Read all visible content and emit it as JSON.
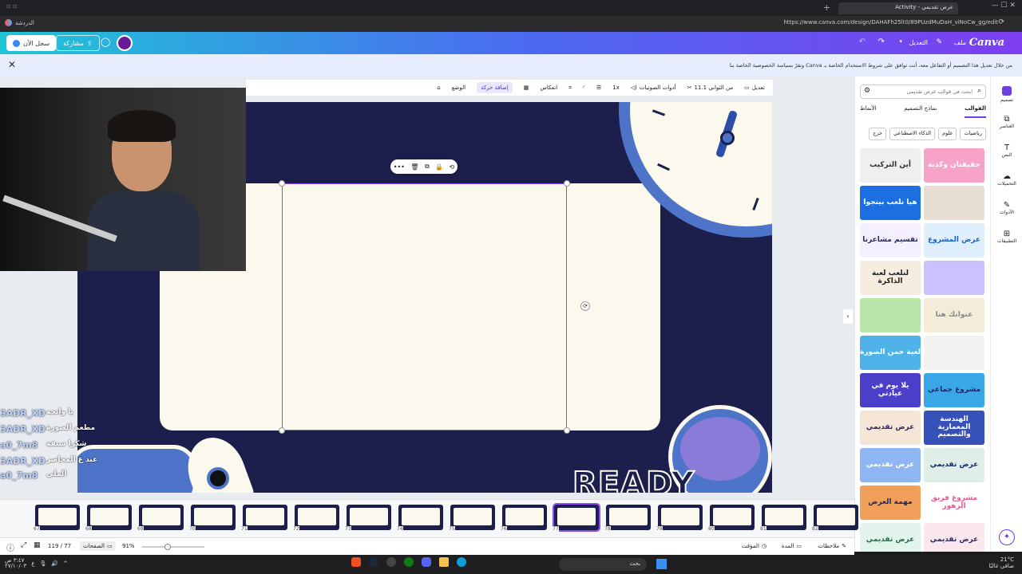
{
  "browser": {
    "tab_title": "عرض تقديمي - Activity",
    "url": "https://www.canva.com/design/DAHAFh25lt0/89PUzdMuDaH_viNoCw_gg/edit",
    "left_tab": "الدردشة"
  },
  "header": {
    "logo": "Canva",
    "menu_file": "ملف",
    "menu_edit": "التعديل",
    "share_label": "مشاركة",
    "signup_label": "سجل الآن"
  },
  "notice": {
    "text": "من خلال تعديل هذا التصميم أو التفاعل معه، أنت توافق على شروط الاستخدام الخاصة بـ Canva وتقرّ بسياسة الخصوصية الخاصة بنا",
    "close_icon": "close-icon"
  },
  "toolbar": {
    "edit": "تعديل",
    "duration": "11.1 من الثواني",
    "audio_tools": "أدوات الصوتيات",
    "speed": "1x",
    "flip": "انعكاس",
    "animate": "إضافة حركة",
    "position": "الوضع"
  },
  "slide": {
    "title_word": "READY",
    "colors": {
      "bg": "#1c1f4b",
      "card": "#fbf8ee",
      "accent": "#4e74c9",
      "selection": "#8a4bf0"
    }
  },
  "panel": {
    "search_placeholder": "ابحث في قوالب عرض تقديمي",
    "tabs": [
      "القوالب",
      "نماذج التصميم",
      "الأنماط"
    ],
    "chips": [
      "رياضيات",
      "علوم",
      "الذكاء الاصطناعي",
      "خرج"
    ],
    "templates": [
      {
        "label": "حقيقتان وكذبة",
        "bg": "#f7a3c8",
        "fg": "#ffffff"
      },
      {
        "label": "أين التركيب",
        "bg": "#efefef",
        "fg": "#333333"
      },
      {
        "label": "",
        "bg": "#e6dfd1",
        "fg": "#333333"
      },
      {
        "label": "هيا نلعب بينجوا",
        "bg": "#1b6fe0",
        "fg": "#ffffff"
      },
      {
        "label": "عرض المشروع",
        "bg": "#dfeefb",
        "fg": "#1b62c5"
      },
      {
        "label": "تقسيم مشاعرنا",
        "bg": "#f5f0ff",
        "fg": "#2b2b5b"
      },
      {
        "label": "",
        "bg": "#c9c2ff",
        "fg": "#333333"
      },
      {
        "label": "لنلعب لعبة الذاكرة",
        "bg": "#f6ede0",
        "fg": "#222222"
      },
      {
        "label": "عنوانك هنا",
        "bg": "#f3ecd8",
        "fg": "#888888"
      },
      {
        "label": "",
        "bg": "#b9e6a8",
        "fg": "#333333"
      },
      {
        "label": "",
        "bg": "#f2f2f2",
        "fg": "#333333"
      },
      {
        "label": "لعبة خمن الصورة",
        "bg": "#4fb3ea",
        "fg": "#ffffff"
      },
      {
        "label": "مشروع جماعي",
        "bg": "#3aa7e8",
        "fg": "#1b2a6b"
      },
      {
        "label": "يلا يوم في عيادتي",
        "bg": "#4b3fc9",
        "fg": "#ffffff"
      },
      {
        "label": "الهندسة المعمارية والتصميم",
        "bg": "#3651b8",
        "fg": "#ffffff"
      },
      {
        "label": "عرض تقديمي",
        "bg": "#f6e6d8",
        "fg": "#2b2b5b"
      },
      {
        "label": "عرض تقديمي",
        "bg": "#dfeee9",
        "fg": "#1b2a6b"
      },
      {
        "label": "عرض تقديمي",
        "bg": "#8fb6f2",
        "fg": "#ffffff"
      },
      {
        "label": "مشروع فريق الزهور",
        "bg": "#ffffff",
        "fg": "#e0608a"
      },
      {
        "label": "مهمة العرض",
        "bg": "#f0a05a",
        "fg": "#1b2a6b"
      },
      {
        "label": "عرض تقديمي",
        "bg": "#fbe7ee",
        "fg": "#2b2b5b"
      },
      {
        "label": "عرض تقديمي",
        "bg": "#e2f4ec",
        "fg": "#2b6b4b"
      }
    ]
  },
  "rail": {
    "items": [
      "تصميم",
      "العناصر",
      "النص",
      "التحميلات",
      "الأدوات",
      "التطبيقات"
    ]
  },
  "thumbnails": {
    "numbers": [
      "67",
      "68",
      "69",
      "70",
      "71",
      "72",
      "73",
      "74",
      "75",
      "76",
      "77",
      "78",
      "79",
      "80",
      "81",
      "82"
    ],
    "active": "77"
  },
  "status": {
    "notes": "ملاحظات",
    "duration": "المدة",
    "timer": "المؤقت",
    "zoom": "91%",
    "pages": "الصفحات",
    "page_count": "119 / 77"
  },
  "chat": {
    "lines": [
      "3ADR_XD",
      "3ADR_XD",
      "a0_7m8",
      "3ADR_XD",
      "a0_7m8"
    ],
    "messages": [
      "يا وانحه",
      "مطعم الصورة",
      "شكرا سبقة",
      "عبد ع المحاضر",
      "الملي"
    ]
  },
  "taskbar": {
    "search": "بحث",
    "time": "٣:٤٧ ص",
    "date": "٢٧/١٠/٠٣",
    "weather": "21°C",
    "weather_desc": "صافي غالبًا"
  }
}
